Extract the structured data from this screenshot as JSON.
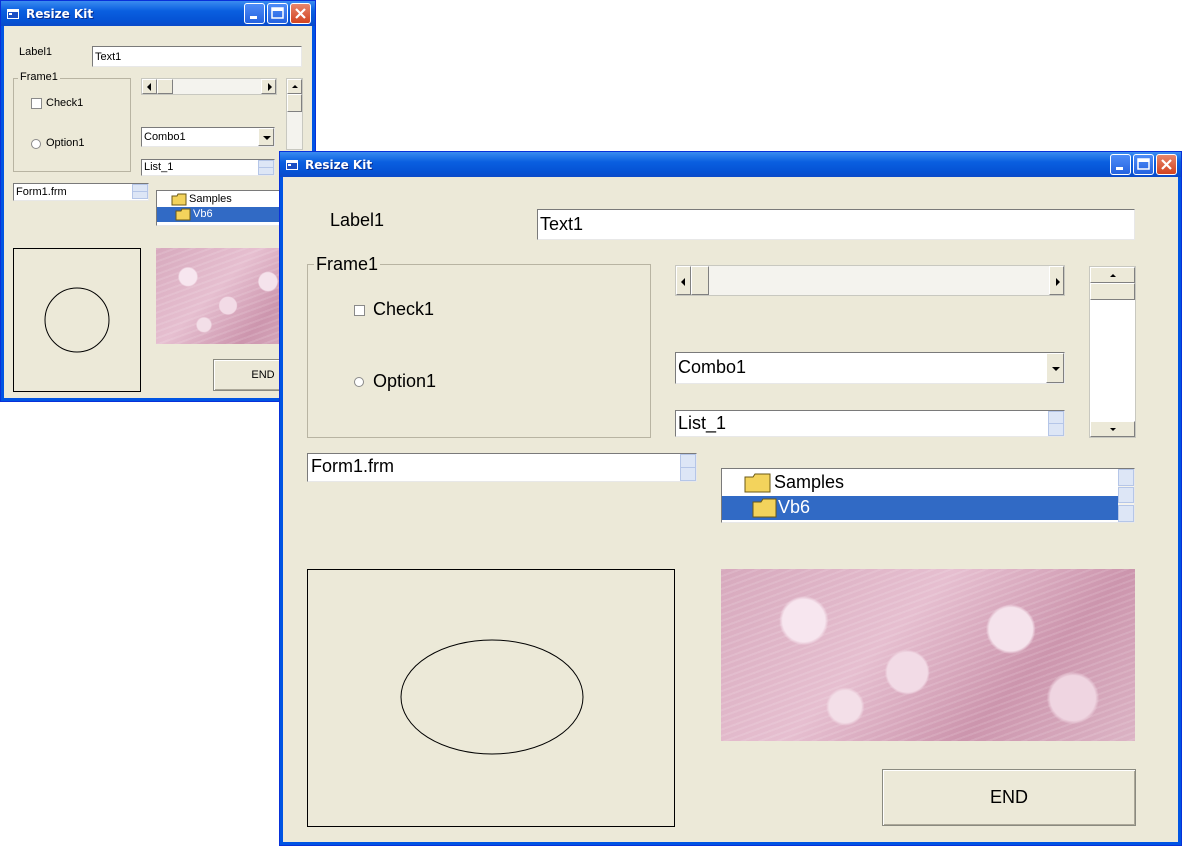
{
  "back_window": {
    "title": "Resize Kit",
    "label1": "Label1",
    "text1": "Text1",
    "frame1": "Frame1",
    "check1": "Check1",
    "option1": "Option1",
    "combo1": "Combo1",
    "list1": "List_1",
    "file": "Form1.frm",
    "tree": [
      "Samples",
      "Vb6"
    ],
    "end": "END"
  },
  "front_window": {
    "title": "Resize Kit",
    "label1": "Label1",
    "text1": "Text1",
    "frame1": "Frame1",
    "check1": "Check1",
    "option1": "Option1",
    "combo1": "Combo1",
    "list1": "List_1",
    "file": "Form1.frm",
    "tree": [
      "Samples",
      "Vb6"
    ],
    "end": "END"
  },
  "colors": {
    "titlebar": "#0a5fe0",
    "selection": "#316ac5",
    "face": "#ece9d8"
  }
}
